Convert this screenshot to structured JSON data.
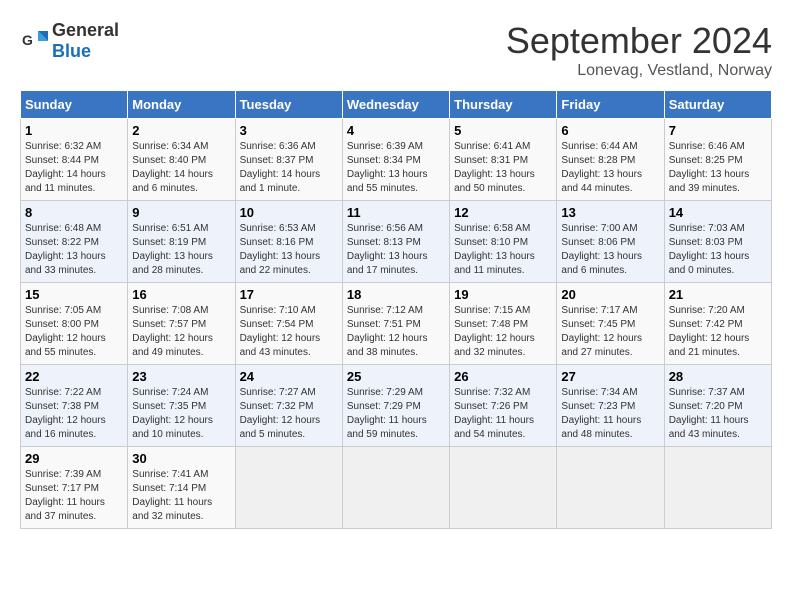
{
  "logo": {
    "text_general": "General",
    "text_blue": "Blue"
  },
  "header": {
    "month": "September 2024",
    "location": "Lonevag, Vestland, Norway"
  },
  "days_of_week": [
    "Sunday",
    "Monday",
    "Tuesday",
    "Wednesday",
    "Thursday",
    "Friday",
    "Saturday"
  ],
  "weeks": [
    [
      {
        "day": "1",
        "info": "Sunrise: 6:32 AM\nSunset: 8:44 PM\nDaylight: 14 hours\nand 11 minutes."
      },
      {
        "day": "2",
        "info": "Sunrise: 6:34 AM\nSunset: 8:40 PM\nDaylight: 14 hours\nand 6 minutes."
      },
      {
        "day": "3",
        "info": "Sunrise: 6:36 AM\nSunset: 8:37 PM\nDaylight: 14 hours\nand 1 minute."
      },
      {
        "day": "4",
        "info": "Sunrise: 6:39 AM\nSunset: 8:34 PM\nDaylight: 13 hours\nand 55 minutes."
      },
      {
        "day": "5",
        "info": "Sunrise: 6:41 AM\nSunset: 8:31 PM\nDaylight: 13 hours\nand 50 minutes."
      },
      {
        "day": "6",
        "info": "Sunrise: 6:44 AM\nSunset: 8:28 PM\nDaylight: 13 hours\nand 44 minutes."
      },
      {
        "day": "7",
        "info": "Sunrise: 6:46 AM\nSunset: 8:25 PM\nDaylight: 13 hours\nand 39 minutes."
      }
    ],
    [
      {
        "day": "8",
        "info": "Sunrise: 6:48 AM\nSunset: 8:22 PM\nDaylight: 13 hours\nand 33 minutes."
      },
      {
        "day": "9",
        "info": "Sunrise: 6:51 AM\nSunset: 8:19 PM\nDaylight: 13 hours\nand 28 minutes."
      },
      {
        "day": "10",
        "info": "Sunrise: 6:53 AM\nSunset: 8:16 PM\nDaylight: 13 hours\nand 22 minutes."
      },
      {
        "day": "11",
        "info": "Sunrise: 6:56 AM\nSunset: 8:13 PM\nDaylight: 13 hours\nand 17 minutes."
      },
      {
        "day": "12",
        "info": "Sunrise: 6:58 AM\nSunset: 8:10 PM\nDaylight: 13 hours\nand 11 minutes."
      },
      {
        "day": "13",
        "info": "Sunrise: 7:00 AM\nSunset: 8:06 PM\nDaylight: 13 hours\nand 6 minutes."
      },
      {
        "day": "14",
        "info": "Sunrise: 7:03 AM\nSunset: 8:03 PM\nDaylight: 13 hours\nand 0 minutes."
      }
    ],
    [
      {
        "day": "15",
        "info": "Sunrise: 7:05 AM\nSunset: 8:00 PM\nDaylight: 12 hours\nand 55 minutes."
      },
      {
        "day": "16",
        "info": "Sunrise: 7:08 AM\nSunset: 7:57 PM\nDaylight: 12 hours\nand 49 minutes."
      },
      {
        "day": "17",
        "info": "Sunrise: 7:10 AM\nSunset: 7:54 PM\nDaylight: 12 hours\nand 43 minutes."
      },
      {
        "day": "18",
        "info": "Sunrise: 7:12 AM\nSunset: 7:51 PM\nDaylight: 12 hours\nand 38 minutes."
      },
      {
        "day": "19",
        "info": "Sunrise: 7:15 AM\nSunset: 7:48 PM\nDaylight: 12 hours\nand 32 minutes."
      },
      {
        "day": "20",
        "info": "Sunrise: 7:17 AM\nSunset: 7:45 PM\nDaylight: 12 hours\nand 27 minutes."
      },
      {
        "day": "21",
        "info": "Sunrise: 7:20 AM\nSunset: 7:42 PM\nDaylight: 12 hours\nand 21 minutes."
      }
    ],
    [
      {
        "day": "22",
        "info": "Sunrise: 7:22 AM\nSunset: 7:38 PM\nDaylight: 12 hours\nand 16 minutes."
      },
      {
        "day": "23",
        "info": "Sunrise: 7:24 AM\nSunset: 7:35 PM\nDaylight: 12 hours\nand 10 minutes."
      },
      {
        "day": "24",
        "info": "Sunrise: 7:27 AM\nSunset: 7:32 PM\nDaylight: 12 hours\nand 5 minutes."
      },
      {
        "day": "25",
        "info": "Sunrise: 7:29 AM\nSunset: 7:29 PM\nDaylight: 11 hours\nand 59 minutes."
      },
      {
        "day": "26",
        "info": "Sunrise: 7:32 AM\nSunset: 7:26 PM\nDaylight: 11 hours\nand 54 minutes."
      },
      {
        "day": "27",
        "info": "Sunrise: 7:34 AM\nSunset: 7:23 PM\nDaylight: 11 hours\nand 48 minutes."
      },
      {
        "day": "28",
        "info": "Sunrise: 7:37 AM\nSunset: 7:20 PM\nDaylight: 11 hours\nand 43 minutes."
      }
    ],
    [
      {
        "day": "29",
        "info": "Sunrise: 7:39 AM\nSunset: 7:17 PM\nDaylight: 11 hours\nand 37 minutes."
      },
      {
        "day": "30",
        "info": "Sunrise: 7:41 AM\nSunset: 7:14 PM\nDaylight: 11 hours\nand 32 minutes."
      },
      {
        "day": "",
        "info": ""
      },
      {
        "day": "",
        "info": ""
      },
      {
        "day": "",
        "info": ""
      },
      {
        "day": "",
        "info": ""
      },
      {
        "day": "",
        "info": ""
      }
    ]
  ]
}
